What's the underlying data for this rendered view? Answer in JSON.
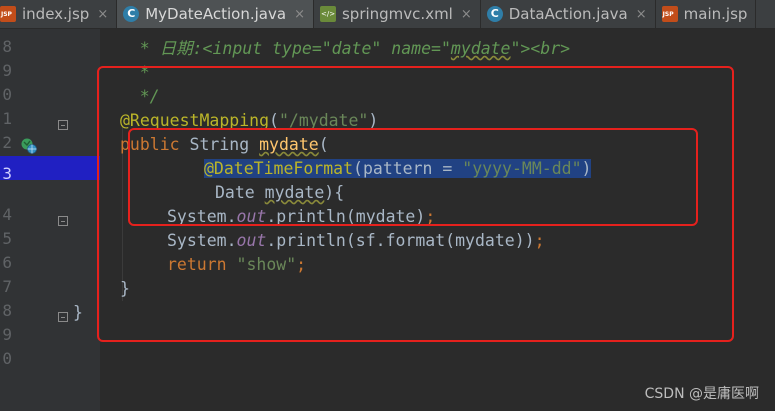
{
  "tabs": [
    {
      "label": "index.jsp",
      "icon": "jsp-file-icon",
      "active": false
    },
    {
      "label": "MyDateAction.java",
      "icon": "java-class-icon",
      "active": true
    },
    {
      "label": "springmvc.xml",
      "icon": "xml-file-icon",
      "active": false
    },
    {
      "label": "DataAction.java",
      "icon": "java-class-icon",
      "active": false
    },
    {
      "label": "main.jsp",
      "icon": "jsp-file-icon",
      "active": false
    }
  ],
  "close_glyph": "×",
  "line_numbers": [
    "8",
    "9",
    "0",
    "1",
    "2",
    "3",
    "4",
    "5",
    "6",
    "7",
    "8",
    "9",
    "0"
  ],
  "code": {
    "l8_prefix": "    * ",
    "l8_comment": "日期:<input type=\"date\" name=\"",
    "l8_word": "mydate",
    "l8_tail": "\"><br>",
    "l9": "    *",
    "l10": "    */",
    "l11_annot": "@RequestMapping",
    "l11_open": "(",
    "l11_str": "\"/mydate\"",
    "l11_close": ")",
    "l12_kw": "public",
    "l12_type": " String ",
    "l12_method": "mydate",
    "l12_open": "(",
    "l13_annot": "@DateTimeFormat",
    "l13_mid": "(pattern = ",
    "l13_str": "\"yyyy-MM-dd\"",
    "l13_close": ")",
    "l14_type": "Date ",
    "l14_param": "mydate",
    "l14_tail": "){",
    "l15_a": "System.",
    "l15_out": "out",
    "l15_b": ".println(mydate)",
    "l15_semi": ";",
    "l16_a": "System.",
    "l16_out": "out",
    "l16_b": ".println(sf.format(mydate))",
    "l16_semi": ";",
    "l17_kw": "return",
    "l17_str": " \"show\"",
    "l17_semi": ";",
    "l18": "}",
    "l19": "}"
  },
  "watermark": "CSDN @是庸医啊"
}
